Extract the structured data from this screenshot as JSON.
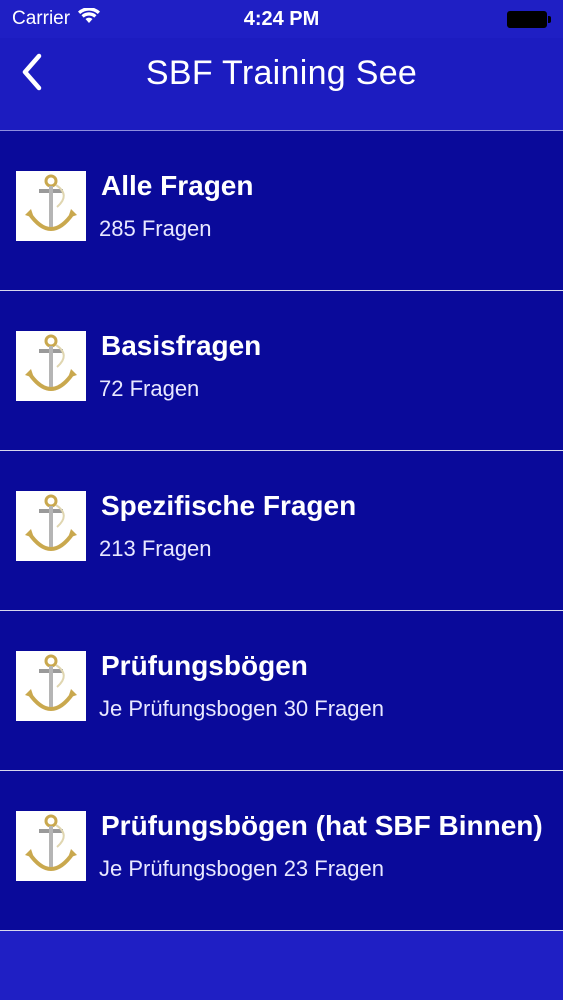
{
  "status_bar": {
    "carrier": "Carrier",
    "time": "4:24 PM"
  },
  "nav": {
    "title": "SBF Training See",
    "back_icon": "chevron-left-icon"
  },
  "list": {
    "items": [
      {
        "title": "Alle Fragen",
        "subtitle": "285 Fragen",
        "icon": "anchor-icon"
      },
      {
        "title": "Basisfragen",
        "subtitle": "72 Fragen",
        "icon": "anchor-icon"
      },
      {
        "title": "Spezifische Fragen",
        "subtitle": "213 Fragen",
        "icon": "anchor-icon"
      },
      {
        "title": "Prüfungsbögen",
        "subtitle": "Je Prüfungsbogen 30 Fragen",
        "icon": "anchor-icon"
      },
      {
        "title": "Prüfungsbögen (hat SBF Binnen)",
        "subtitle": "Je Prüfungsbogen 23 Fragen",
        "icon": "anchor-icon"
      }
    ]
  },
  "colors": {
    "background": "#1f1fc4",
    "nav_background": "#1c1cc0",
    "cell_background": "#0a0a9a",
    "separator": "#d8d8ee",
    "text": "#ffffff"
  }
}
